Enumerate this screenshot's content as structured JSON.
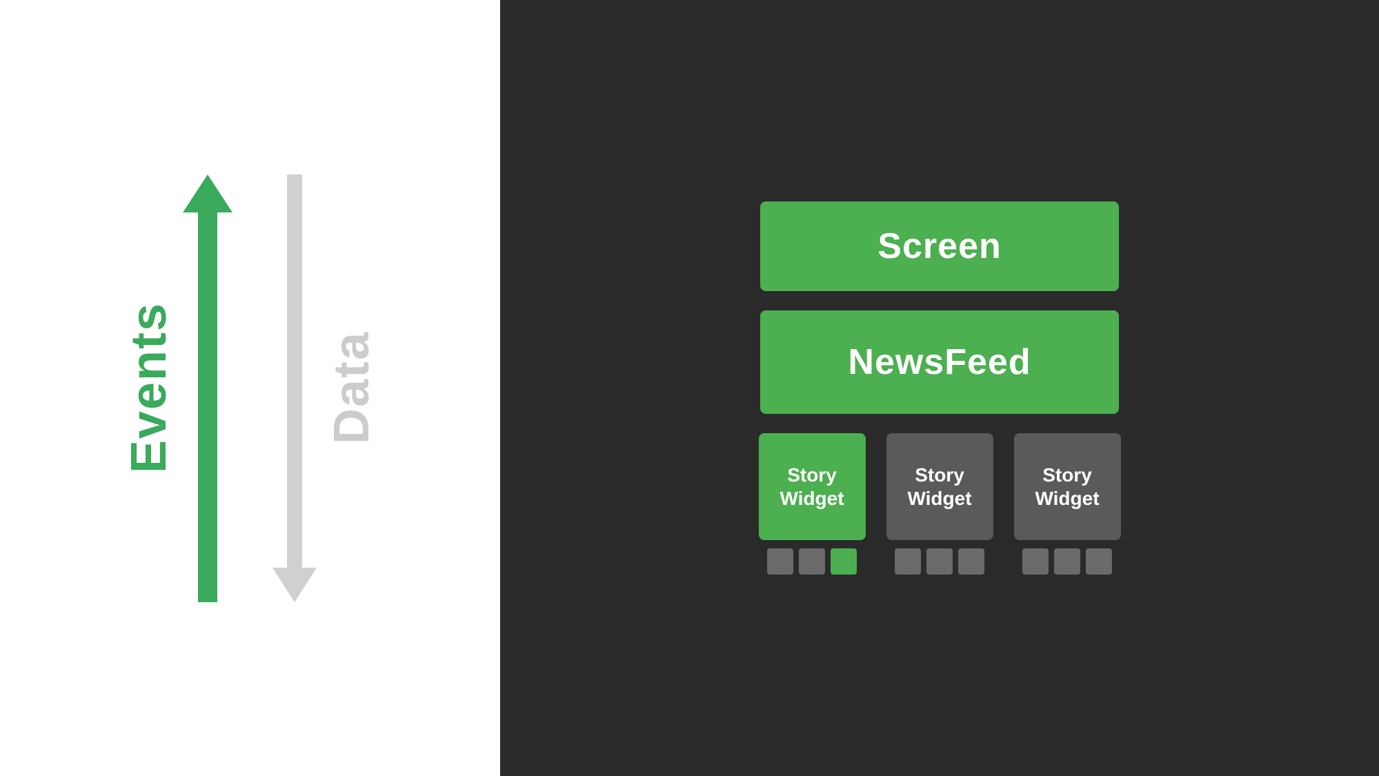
{
  "left": {
    "events_label": "Events",
    "data_label": "Data"
  },
  "right": {
    "screen_label": "Screen",
    "newsfeed_label": "NewsFeed",
    "story_widget_label": "Story Widget",
    "widgets": [
      {
        "id": "widget-1",
        "color": "green",
        "indicators": [
          "gray",
          "gray",
          "green"
        ]
      },
      {
        "id": "widget-2",
        "color": "gray",
        "indicators": [
          "gray",
          "gray",
          "gray"
        ]
      },
      {
        "id": "widget-3",
        "color": "gray",
        "indicators": [
          "gray",
          "gray",
          "gray"
        ]
      }
    ]
  },
  "colors": {
    "green": "#4caf50",
    "gray": "#5a5a5a",
    "indicator_gray": "#6a6a6a",
    "left_bg": "#ffffff",
    "right_bg": "#2a2a2a",
    "events_color": "#3aaa5c",
    "data_color": "#cccccc"
  }
}
